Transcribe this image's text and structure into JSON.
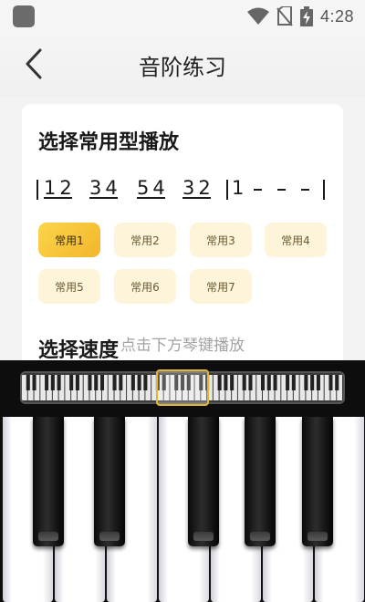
{
  "status_bar": {
    "time": "4:28",
    "icons": [
      "app-notification-icon",
      "wifi-icon",
      "no-sim-icon",
      "battery-charging-icon"
    ]
  },
  "header": {
    "title": "音阶练习",
    "back_icon": "chevron-left-icon"
  },
  "section_pattern": {
    "title": "选择常用型播放",
    "notation": {
      "groups": [
        "12",
        "34",
        "54",
        "32"
      ],
      "held_note": "1",
      "dashes": 3
    },
    "chips": [
      {
        "label": "常用1",
        "active": true
      },
      {
        "label": "常用2",
        "active": false
      },
      {
        "label": "常用3",
        "active": false
      },
      {
        "label": "常用4",
        "active": false
      },
      {
        "label": "常用5",
        "active": false
      },
      {
        "label": "常用6",
        "active": false
      },
      {
        "label": "常用7",
        "active": false
      }
    ]
  },
  "section_speed": {
    "title": "选择速度"
  },
  "hint": "点击下方琴键播放",
  "colors": {
    "accent": "#f3b62b",
    "chip_bg": "#fdf4d9",
    "piano_bg": "#0d0d0d"
  }
}
